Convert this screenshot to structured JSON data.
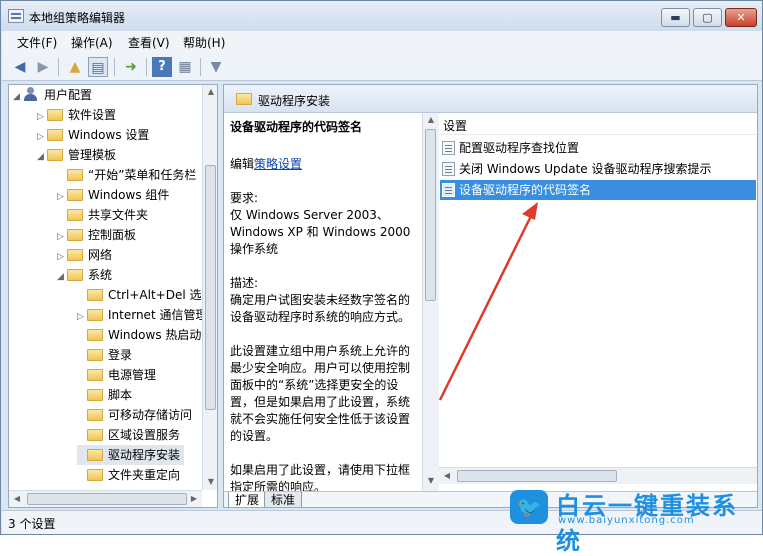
{
  "window": {
    "title": "本地组策略编辑器",
    "buttons": {
      "minimize": "▬",
      "maximize": "▢",
      "close": "✕"
    }
  },
  "menu": {
    "items": [
      "文件(F)",
      "操作(A)",
      "查看(V)",
      "帮助(H)"
    ]
  },
  "toolbar": {
    "icons": [
      "back-icon",
      "forward-icon",
      "up-folder-icon",
      "show-hide-tree-icon",
      "export-list-icon",
      "help-icon",
      "properties-icon",
      "filter-icon"
    ]
  },
  "tree": {
    "root": "用户配置",
    "items": [
      {
        "label": "软件设置"
      },
      {
        "label": "Windows 设置"
      },
      {
        "label": "管理模板"
      },
      {
        "label": "“开始”菜单和任务栏"
      },
      {
        "label": "Windows 组件"
      },
      {
        "label": "共享文件夹"
      },
      {
        "label": "控制面板"
      },
      {
        "label": "网络"
      },
      {
        "label": "系统"
      },
      {
        "label": "Ctrl+Alt+Del 选项"
      },
      {
        "label": "Internet 通信管理"
      },
      {
        "label": "Windows 热启动"
      },
      {
        "label": "登录"
      },
      {
        "label": "电源管理"
      },
      {
        "label": "脚本"
      },
      {
        "label": "可移动存储访问"
      },
      {
        "label": "区域设置服务"
      },
      {
        "label": "驱动程序安装"
      },
      {
        "label": "文件夹重定向"
      }
    ]
  },
  "header": {
    "title": "驱动程序安装"
  },
  "description": {
    "title": "设备驱动程序的代码签名",
    "edit_prefix": "编辑",
    "edit_link": "策略设置",
    "req_label": "要求:",
    "req_lines": [
      "仅 Windows Server 2003、",
      "Windows XP 和 Windows 2000",
      "操作系统"
    ],
    "desc_label": "描述:",
    "desc_lines": [
      "确定用户试图安装未经数字签名的",
      "设备驱动程序时系统的响应方式。"
    ],
    "body_lines": [
      "此设置建立组中用户系统上允许的",
      "最少安全响应。用户可以使用控制",
      "面板中的“系统”选择更安全的设",
      "置，但是如果启用了此设置，系统",
      "就不会实施任何安全性低于该设置",
      "的设置。"
    ],
    "tail_lines": [
      "如果启用了此设置，请使用下拉框",
      "指定所需的响应。"
    ]
  },
  "settings": {
    "header": "设置",
    "rows": [
      {
        "label": "配置驱动程序查找位置",
        "selected": false
      },
      {
        "label": "关闭 Windows Update 设备驱动程序搜索提示",
        "selected": false
      },
      {
        "label": "设备驱动程序的代码签名",
        "selected": true
      }
    ]
  },
  "tabs": [
    "扩展",
    "标准"
  ],
  "status": {
    "text": "3 个设置"
  },
  "watermark": {
    "name": "白云一键重装系统",
    "url": "www.baiyunxitong.com",
    "logo_icon": "bird-icon"
  },
  "colors": {
    "selection": "#3a8ee0",
    "annotation_arrow": "#e03a2a"
  }
}
